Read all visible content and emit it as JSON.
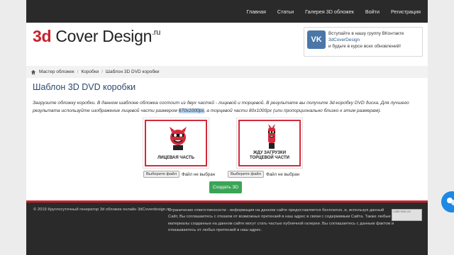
{
  "nav": {
    "items": [
      "Главная",
      "Статьи",
      "Галерея 3D обложек",
      "Войти",
      "Регистрация"
    ]
  },
  "logo": {
    "prefix": "3d",
    "main": "Cover Design",
    "tld": ".ru"
  },
  "vk": {
    "logo_text": "VK",
    "line1": "Вступайте в нашу группу ВКонтакте",
    "link": "3dCoverDesign",
    "line3": "и будьте в курсе всех обновлений!"
  },
  "breadcrumb": {
    "items": [
      "Мастер обложек",
      "Коробки",
      "Шаблон 3D DVD коробки"
    ]
  },
  "page_title": "Шаблон 3D DVD коробки",
  "description": {
    "before": "Загрузите обложку коробки. В данном шаблоне обложка состоит из двух частей - лицевой и торцевой. В результате вы получите 3d-коробку DVD диска. Для лучшего результата используйте изображение лицевой части размером ",
    "highlight": "670x1000px",
    "after": ", а торцевой части 80x1000px (или пропорционально близко к этим размерам)."
  },
  "cards": {
    "front": {
      "caption": "ЛИЦЕВАЯ ЧАСТЬ"
    },
    "side": {
      "caption_line1": "ЖДУ ЗАГРУЗКИ",
      "caption_line2": "ТОРЦЕВОЙ ЧАСТИ"
    }
  },
  "file_inputs": {
    "front": {
      "button": "Выберите файл",
      "status": "Файл не выбран"
    },
    "side": {
      "button": "Выберите файл",
      "status": "Файл не выбран"
    }
  },
  "create_button": "Создать 3D",
  "footer": {
    "copyright": "© 2019 Круглосуточный генератор 3d обложек онлайн 3dCoverdesign.ru",
    "legal": "Ограничение ответственности - информация на данном сайте предоставляется бесплатно, и, используя данный Сайт, Вы соглашаетесь с отказом от возможных претензий в наш адрес в связи с содержимым Сайта. Также любые материалы созданные на данном сайте могут стать частью публичной галереи. Вы соглашаетесь с данным фактом и отказываетесь от любых претензий в наш адрес.",
    "badge": "CARD ENG LIS"
  },
  "colors": {
    "brand_red": "#c8202c",
    "nav_bg": "#2a2a2a",
    "vk_blue": "#4a76a8",
    "create_green": "#3aa556",
    "title_blue": "#2b4a6b",
    "fab_blue": "#1e88e5"
  },
  "icons": {
    "home": "home-icon",
    "mascot": "devil-mascot-icon",
    "chat": "chat-bubble-icon"
  }
}
